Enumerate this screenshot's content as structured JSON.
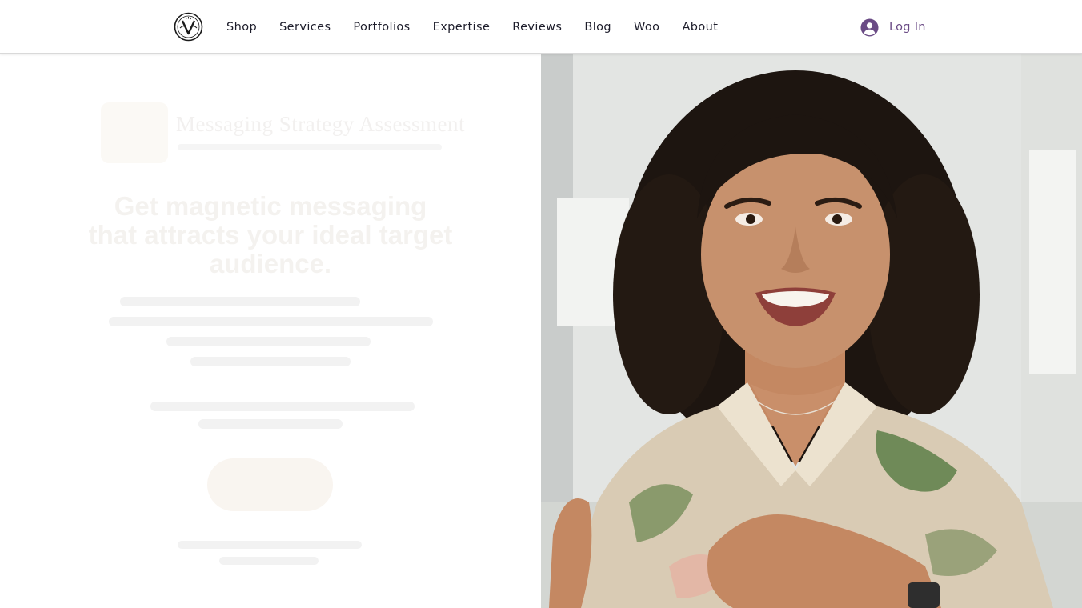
{
  "header": {
    "logo_icon": "v-monogram-logo-icon",
    "nav": [
      {
        "label": "Shop"
      },
      {
        "label": "Services"
      },
      {
        "label": "Portfolios"
      },
      {
        "label": "Expertise"
      },
      {
        "label": "Reviews"
      },
      {
        "label": "Blog"
      },
      {
        "label": "Woo"
      },
      {
        "label": "About"
      }
    ],
    "login": {
      "label": "Log In",
      "icon": "user-avatar-icon",
      "color": "#6a4b85"
    }
  },
  "hero": {
    "brand_title": "Messaging Strategy Assessment",
    "headline": "Get magnetic messaging that attracts your ideal target audience.",
    "photo_alt_icon": "smiling-woman-photo",
    "accent_color": "#a96a22"
  }
}
